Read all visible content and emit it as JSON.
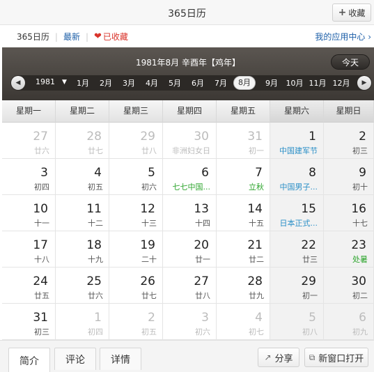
{
  "window": {
    "title": "365日历",
    "fav_button": "收藏"
  },
  "subnav": {
    "app_name": "365日历",
    "latest": "最新",
    "favorited": "已收藏",
    "app_center": "我的应用中心 ›"
  },
  "calendar": {
    "header_title": "1981年8月  辛酉年【鸡年】",
    "today_button": "今天",
    "year": "1981",
    "months": [
      "1月",
      "2月",
      "3月",
      "4月",
      "5月",
      "6月",
      "7月",
      "8月",
      "9月",
      "10月",
      "11月",
      "12月"
    ],
    "selected_month": "8月",
    "weekdays": [
      "星期一",
      "星期二",
      "星期三",
      "星期四",
      "星期五",
      "星期六",
      "星期日"
    ],
    "weeks": [
      [
        {
          "day": "27",
          "lunar": "廿六",
          "other": true
        },
        {
          "day": "28",
          "lunar": "廿七",
          "other": true
        },
        {
          "day": "29",
          "lunar": "廿八",
          "other": true
        },
        {
          "day": "30",
          "lunar": "非洲妇女日",
          "other": true
        },
        {
          "day": "31",
          "lunar": "初一",
          "other": true
        },
        {
          "day": "1",
          "lunar": "中国建军节",
          "style": "blue"
        },
        {
          "day": "2",
          "lunar": "初三"
        }
      ],
      [
        {
          "day": "3",
          "lunar": "初四"
        },
        {
          "day": "4",
          "lunar": "初五"
        },
        {
          "day": "5",
          "lunar": "初六"
        },
        {
          "day": "6",
          "lunar": "七七中国...",
          "style": "green"
        },
        {
          "day": "7",
          "lunar": "立秋",
          "style": "green"
        },
        {
          "day": "8",
          "lunar": "中国男子...",
          "style": "blue"
        },
        {
          "day": "9",
          "lunar": "初十"
        }
      ],
      [
        {
          "day": "10",
          "lunar": "十一"
        },
        {
          "day": "11",
          "lunar": "十二"
        },
        {
          "day": "12",
          "lunar": "十三"
        },
        {
          "day": "13",
          "lunar": "十四"
        },
        {
          "day": "14",
          "lunar": "十五"
        },
        {
          "day": "15",
          "lunar": "日本正式...",
          "style": "blue"
        },
        {
          "day": "16",
          "lunar": "十七"
        }
      ],
      [
        {
          "day": "17",
          "lunar": "十八"
        },
        {
          "day": "18",
          "lunar": "十九"
        },
        {
          "day": "19",
          "lunar": "二十"
        },
        {
          "day": "20",
          "lunar": "廿一"
        },
        {
          "day": "21",
          "lunar": "廿二"
        },
        {
          "day": "22",
          "lunar": "廿三"
        },
        {
          "day": "23",
          "lunar": "处暑",
          "style": "green"
        }
      ],
      [
        {
          "day": "24",
          "lunar": "廿五"
        },
        {
          "day": "25",
          "lunar": "廿六"
        },
        {
          "day": "26",
          "lunar": "廿七"
        },
        {
          "day": "27",
          "lunar": "廿八"
        },
        {
          "day": "28",
          "lunar": "廿九"
        },
        {
          "day": "29",
          "lunar": "初一"
        },
        {
          "day": "30",
          "lunar": "初二"
        }
      ],
      [
        {
          "day": "31",
          "lunar": "初三"
        },
        {
          "day": "1",
          "lunar": "初四",
          "other": true
        },
        {
          "day": "2",
          "lunar": "初五",
          "other": true
        },
        {
          "day": "3",
          "lunar": "初六",
          "other": true
        },
        {
          "day": "4",
          "lunar": "初七",
          "other": true
        },
        {
          "day": "5",
          "lunar": "初八",
          "other": true
        },
        {
          "day": "6",
          "lunar": "初九",
          "other": true
        }
      ]
    ]
  },
  "bottom": {
    "tabs": [
      "简介",
      "评论",
      "详情"
    ],
    "share": "分享",
    "open_new_window": "新窗口打开"
  }
}
